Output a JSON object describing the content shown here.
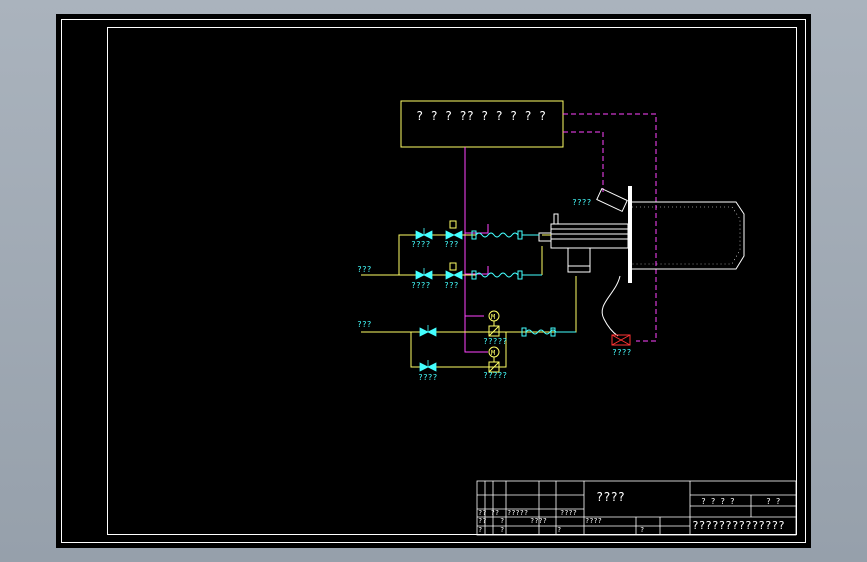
{
  "colors": {
    "sheet": "#000000",
    "frame": "#ffffff",
    "control_box": "#ffff66",
    "signal_line": "#ff44ff",
    "gas_line": "#ffff66",
    "hose": "#44ffff",
    "label": "#44ffff",
    "valve": "#44ffff",
    "alarm": "#ff3333",
    "motor": "#ffff66"
  },
  "control_box": {
    "label": "? ? ? ?? ? ? ? ? ?"
  },
  "labels": {
    "camera": "????",
    "valve1": "????",
    "valve1b": "???",
    "valve2": "????",
    "valve2b": "???",
    "inlet1": "???",
    "inlet2": "???",
    "motor_valve1": "?????",
    "bypass_valve": "????",
    "motor_valve2": "?????",
    "alarm": "????"
  },
  "motor_symbol": "M",
  "title_block": {
    "drawing_title": "????",
    "company": "??????????????",
    "row_labels": [
      "?? ??",
      "?????",
      "????",
      "??",
      "?",
      "?",
      "????",
      "?",
      "?",
      "????",
      "?"
    ],
    "scale_labels": [
      "? ? ? ?",
      "? ?"
    ]
  }
}
